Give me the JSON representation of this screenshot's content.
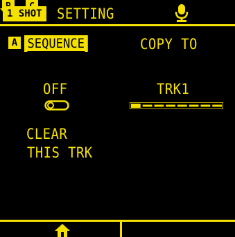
{
  "header": {
    "mode_badge": "1 SHOT",
    "title": "SETTING",
    "mic_icon": "microphone-icon"
  },
  "options": {
    "a_key": "A",
    "sequence_label": "SEQUENCE",
    "b_key_icon": "arrow-down-b-icon",
    "copy_to_label": "COPY TO"
  },
  "toggle": {
    "value": "OFF",
    "state": false
  },
  "track": {
    "value": "TRK1",
    "selected_segment": 1,
    "total_segments": 8
  },
  "clear": {
    "c_key_icon": "arrow-down-c-icon",
    "line1": "CLEAR",
    "line2": "THIS TRK"
  },
  "footer": {
    "home_icon": "home-icon"
  },
  "colors": {
    "accent": "#f5e100",
    "background": "#000000"
  }
}
